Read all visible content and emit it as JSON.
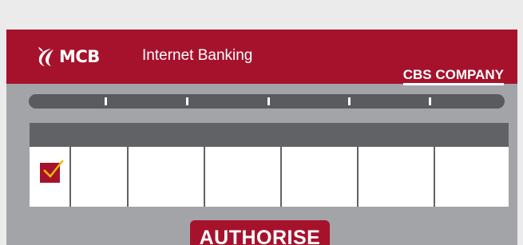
{
  "header": {
    "logo_text": "MCB",
    "app_title": "Internet Banking",
    "company": "CBS COMPANY"
  },
  "progress_ticks": 5,
  "table": {
    "columns": 7,
    "first_row_checked": true
  },
  "actions": {
    "authorise_label": "AUTHORISE"
  },
  "colors": {
    "brand": "#a6122c",
    "background": "#ebebec",
    "panel": "#a3a4a7",
    "dark_gray": "#616266",
    "check": "#f5b800"
  },
  "icons": {
    "logo": "mcb-logo-icon",
    "check": "checkmark-icon"
  }
}
